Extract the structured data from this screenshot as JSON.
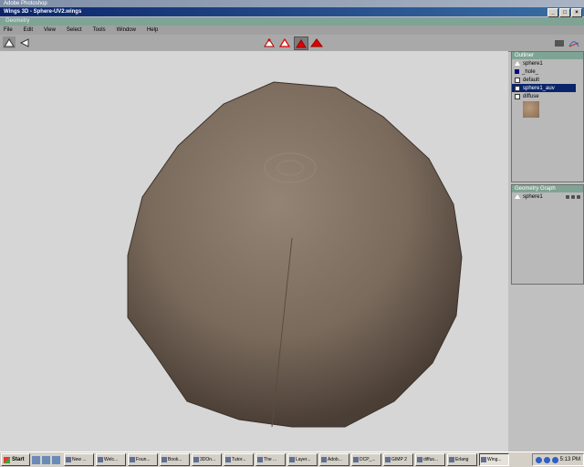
{
  "photoshop_title": "Adobe Photoshop",
  "window": {
    "title": "Wings 3D - Sphere-UV2.wings"
  },
  "geometry_bar": "Geometry",
  "menu": [
    "File",
    "Edit",
    "View",
    "Select",
    "Tools",
    "Window",
    "Help"
  ],
  "outliner": {
    "title": "Outliner",
    "items": [
      {
        "label": "sphere1",
        "icon": "object-icon",
        "selected": false
      },
      {
        "label": "_hole_",
        "icon": "material-icon",
        "selected": false
      },
      {
        "label": "default",
        "icon": "material-icon",
        "selected": false
      },
      {
        "label": "sphere1_auv",
        "icon": "material-icon",
        "selected": true
      },
      {
        "label": "diffuse",
        "icon": "image-icon",
        "selected": false
      }
    ]
  },
  "geometry_graph": {
    "title": "Geometry Graph",
    "items": [
      {
        "label": "sphere1"
      }
    ]
  },
  "taskbar": {
    "start": "Start",
    "tasks": [
      "New ...",
      "Welc...",
      "Foun...",
      "Book...",
      "3DOn...",
      "Tutor...",
      "The ...",
      "Layer...",
      "Adob...",
      "DCP_...",
      "GIMP 2",
      "diffus...",
      "Erlang",
      "Wing..."
    ],
    "active_task": "Wing...",
    "clock": "5:13 PM"
  }
}
